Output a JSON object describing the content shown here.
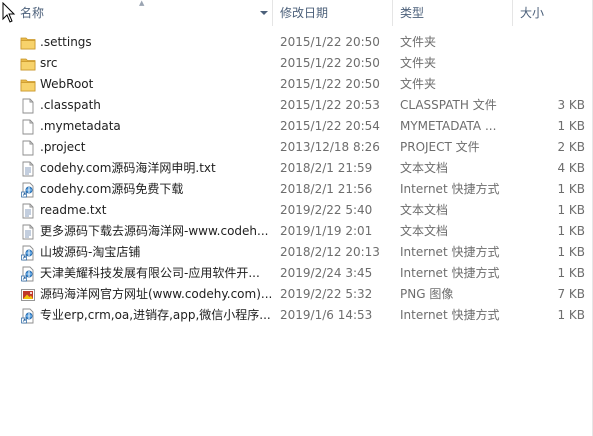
{
  "columns": {
    "name": "名称",
    "date": "修改日期",
    "type": "类型",
    "size": "大小"
  },
  "files": [
    {
      "name": ".settings",
      "date": "2015/1/22 20:50",
      "type": "文件夹",
      "size": "",
      "icon": "folder-icon"
    },
    {
      "name": "src",
      "date": "2015/1/22 20:50",
      "type": "文件夹",
      "size": "",
      "icon": "folder-icon"
    },
    {
      "name": "WebRoot",
      "date": "2015/1/22 20:50",
      "type": "文件夹",
      "size": "",
      "icon": "folder-icon"
    },
    {
      "name": ".classpath",
      "date": "2015/1/22 20:53",
      "type": "CLASSPATH 文件",
      "size": "3 KB",
      "icon": "file-icon"
    },
    {
      "name": ".mymetadata",
      "date": "2015/1/22 20:54",
      "type": "MYMETADATA ...",
      "size": "1 KB",
      "icon": "file-icon"
    },
    {
      "name": ".project",
      "date": "2013/12/18 8:26",
      "type": "PROJECT 文件",
      "size": "2 KB",
      "icon": "file-icon"
    },
    {
      "name": "codehy.com源码海洋网申明.txt",
      "date": "2018/2/1 21:59",
      "type": "文本文档",
      "size": "4 KB",
      "icon": "text-document-icon"
    },
    {
      "name": "codehy.com源码免费下载",
      "date": "2018/2/1 21:56",
      "type": "Internet 快捷方式",
      "size": "1 KB",
      "icon": "internet-shortcut-icon"
    },
    {
      "name": "readme.txt",
      "date": "2019/2/22 5:40",
      "type": "文本文档",
      "size": "1 KB",
      "icon": "text-document-icon"
    },
    {
      "name": "更多源码下载去源码海洋网-www.codeh...",
      "date": "2019/1/19 2:01",
      "type": "文本文档",
      "size": "1 KB",
      "icon": "text-document-icon"
    },
    {
      "name": "山坡源码-淘宝店铺",
      "date": "2018/2/12 20:13",
      "type": "Internet 快捷方式",
      "size": "1 KB",
      "icon": "internet-shortcut-icon"
    },
    {
      "name": "天津美耀科技发展有限公司-应用软件开...",
      "date": "2019/2/24 3:45",
      "type": "Internet 快捷方式",
      "size": "1 KB",
      "icon": "internet-shortcut-icon"
    },
    {
      "name": "源码海洋网官方网址(www.codehy.com)...",
      "date": "2019/2/22 5:32",
      "type": "PNG 图像",
      "size": "7 KB",
      "icon": "png-image-icon"
    },
    {
      "name": "专业erp,crm,oa,进销存,app,微信小程序...",
      "date": "2019/1/6 14:53",
      "type": "Internet 快捷方式",
      "size": "1 KB",
      "icon": "internet-shortcut-icon"
    }
  ],
  "colors": {
    "header_text": "#4c607a",
    "folder": "#e8b94a",
    "muted_text": "#6d6d6d"
  }
}
